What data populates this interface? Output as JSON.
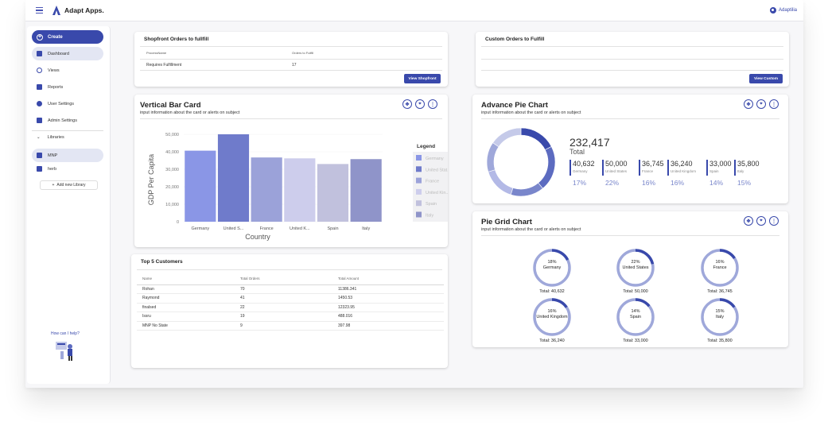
{
  "app": {
    "title": "Adapt Apps.",
    "user": "Adaptilia"
  },
  "sidebar": {
    "create_label": "Create",
    "items": [
      {
        "label": "Dashboard"
      },
      {
        "label": "Views"
      },
      {
        "label": "Reports"
      },
      {
        "label": "User Settings"
      },
      {
        "label": "Admin Settings"
      }
    ],
    "libraries_label": "Libraries",
    "libraries": [
      {
        "label": "MNP"
      },
      {
        "label": "herb"
      }
    ],
    "add_library_label": "Add new Library",
    "help_label": "How can I help?"
  },
  "shopfront": {
    "title": "Shopfront Orders to fullfill",
    "col1": "ProcessName",
    "col2": "Orders to Fulfill",
    "row_name": "Requires Fulfillment",
    "row_value": "17",
    "button": "View Shopfront"
  },
  "custom_orders": {
    "title": "Custom Orders to Fulfill",
    "button": "View Custom"
  },
  "vertical_bar": {
    "title": "Vertical Bar Card",
    "subtitle": "input information  about the card or alerts on subject",
    "legend_title": "Legend"
  },
  "advance_pie": {
    "title": "Advance Pie Chart",
    "subtitle": "input information  about the card or alerts on subject",
    "total_value": "232,417",
    "total_label": "Total",
    "stats": [
      {
        "value": "40,632",
        "country": "Germany",
        "percent": "17%"
      },
      {
        "value": "50,000",
        "country": "United States",
        "percent": "22%"
      },
      {
        "value": "36,745",
        "country": "France",
        "percent": "16%"
      },
      {
        "value": "36,240",
        "country": "United Kingdom",
        "percent": "16%"
      },
      {
        "value": "33,000",
        "country": "Spain",
        "percent": "14%"
      },
      {
        "value": "35,800",
        "country": "Italy",
        "percent": "15%"
      }
    ]
  },
  "pie_grid": {
    "title": "Pie Grid Chart",
    "subtitle": "input information  about the card or alerts on subject",
    "items": [
      {
        "percent": "18%",
        "country": "Germany",
        "total": "Total: 40,632",
        "fraction": 0.175
      },
      {
        "percent": "22%",
        "country": "United States",
        "total": "Total: 50,000",
        "fraction": 0.215
      },
      {
        "percent": "16%",
        "country": "France",
        "total": "Total: 36,745",
        "fraction": 0.158
      },
      {
        "percent": "16%",
        "country": "United Kingdom",
        "total": "Total: 36,240",
        "fraction": 0.156
      },
      {
        "percent": "14%",
        "country": "Spain",
        "total": "Total: 33,000",
        "fraction": 0.142
      },
      {
        "percent": "15%",
        "country": "Italy",
        "total": "Total: 35,800",
        "fraction": 0.154
      }
    ]
  },
  "customers": {
    "title": "Top 5 Customers",
    "headers": [
      "Name",
      "Total Orders",
      "Total Amount"
    ],
    "rows": [
      [
        "Rohan",
        "70",
        "11386.341"
      ],
      [
        "Raymond",
        "41",
        "1450.53"
      ],
      [
        "finalsed",
        "22",
        "12323.95"
      ],
      [
        "Issru",
        "19",
        "488.016"
      ],
      [
        "MNP No State",
        "9",
        "397.98"
      ]
    ]
  },
  "chart_data": [
    {
      "type": "bar",
      "title": "Vertical Bar Card",
      "xlabel": "Country",
      "ylabel": "GDP Per Capita",
      "categories": [
        "Germany",
        "United S...",
        "France",
        "United K...",
        "Spain",
        "Italy"
      ],
      "legend": [
        "Germany",
        "United Stat...",
        "France",
        "United Kin...",
        "Spain",
        "Italy"
      ],
      "values": [
        40632,
        50000,
        36745,
        36240,
        33000,
        35800
      ],
      "yticks": [
        "0",
        "10,000",
        "20,000",
        "30,000",
        "40,000",
        "50,000"
      ],
      "ylim": [
        0,
        50000
      ],
      "colors": [
        "#8a96e6",
        "#6f7bcb",
        "#9ba2d9",
        "#cdcdec",
        "#c1c1dd",
        "#8f94c9"
      ],
      "legend_placement": "right"
    },
    {
      "type": "pie",
      "title": "Advance Pie Chart",
      "categories": [
        "Germany",
        "United States",
        "France",
        "United Kingdom",
        "Spain",
        "Italy"
      ],
      "values": [
        40632,
        50000,
        36745,
        36240,
        33000,
        35800
      ],
      "colors": [
        "#3949ab",
        "#5c6bc0",
        "#7986cb",
        "#b3b9e6",
        "#9fa8da",
        "#c5cae9"
      ]
    }
  ]
}
